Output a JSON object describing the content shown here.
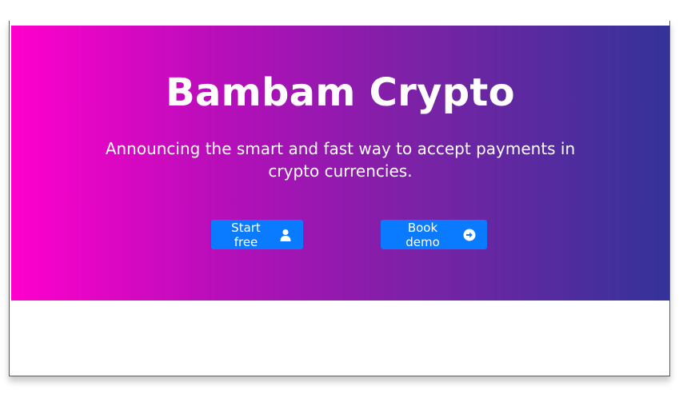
{
  "hero": {
    "title": "Bambam Crypto",
    "subtitle": "Announcing the smart and fast way to accept payments in crypto currencies.",
    "gradient": [
      "#ff00cc",
      "#333399"
    ]
  },
  "buttons": {
    "start_free": {
      "label": "Start free",
      "icon": "user-icon"
    },
    "book_demo": {
      "label": "Book demo",
      "icon": "arrow-circle-right-icon"
    }
  },
  "colors": {
    "button_bg": "#0a7bff",
    "text": "#ffffff"
  }
}
